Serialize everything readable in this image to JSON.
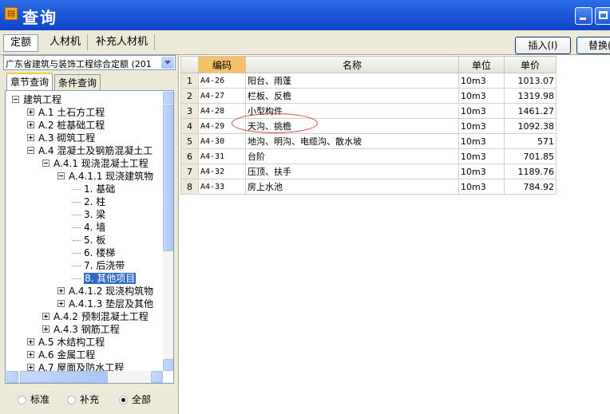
{
  "window": {
    "title": "查询",
    "icon": "app-icon"
  },
  "top_tabs": [
    "定额",
    "人材机",
    "补充人材机"
  ],
  "buttons": {
    "insert": "插入(I)",
    "replace": "替换("
  },
  "left": {
    "dropdown_value": "广东省建筑与装饰工程综合定额 (201",
    "subtabs": [
      "章节查询",
      "条件查询"
    ],
    "tree": [
      {
        "label": "建筑工程",
        "indent": 0,
        "exp": "minus"
      },
      {
        "label": "A.1 土石方工程",
        "indent": 1,
        "exp": "plus"
      },
      {
        "label": "A.2 桩基础工程",
        "indent": 1,
        "exp": "plus"
      },
      {
        "label": "A.3 砌筑工程",
        "indent": 1,
        "exp": "plus"
      },
      {
        "label": "A.4 混凝土及钢筋混凝土工",
        "indent": 1,
        "exp": "minus"
      },
      {
        "label": "A.4.1 现浇混凝土工程",
        "indent": 2,
        "exp": "minus"
      },
      {
        "label": "A.4.1.1 现浇建筑物",
        "indent": 3,
        "exp": "minus"
      },
      {
        "label": "1. 基础",
        "indent": 4,
        "exp": "leaf"
      },
      {
        "label": "2. 柱",
        "indent": 4,
        "exp": "leaf"
      },
      {
        "label": "3. 梁",
        "indent": 4,
        "exp": "leaf"
      },
      {
        "label": "4. 墙",
        "indent": 4,
        "exp": "leaf"
      },
      {
        "label": "5. 板",
        "indent": 4,
        "exp": "leaf"
      },
      {
        "label": "6. 楼梯",
        "indent": 4,
        "exp": "leaf"
      },
      {
        "label": "7. 后浇带",
        "indent": 4,
        "exp": "leaf"
      },
      {
        "label": "8. 其他项目",
        "indent": 4,
        "exp": "leaf",
        "selected": true
      },
      {
        "label": "A.4.1.2 现浇构筑物",
        "indent": 3,
        "exp": "plus"
      },
      {
        "label": "A.4.1.3 垫层及其他",
        "indent": 3,
        "exp": "plus"
      },
      {
        "label": "A.4.2 预制混凝土工程",
        "indent": 2,
        "exp": "plus"
      },
      {
        "label": "A.4.3 钢筋工程",
        "indent": 2,
        "exp": "plus"
      },
      {
        "label": "A.5 木结构工程",
        "indent": 1,
        "exp": "plus"
      },
      {
        "label": "A.6 金属工程",
        "indent": 1,
        "exp": "plus"
      },
      {
        "label": "A.7 屋面及防水工程",
        "indent": 1,
        "exp": "plus"
      }
    ],
    "radios": [
      {
        "label": "标准",
        "checked": false
      },
      {
        "label": "补充",
        "checked": false
      },
      {
        "label": "全部",
        "checked": true
      }
    ]
  },
  "table": {
    "headers": [
      "编码",
      "名称",
      "单位",
      "单价"
    ],
    "rows": [
      {
        "n": "1",
        "code": "A4-26",
        "name": "阳台、雨蓬",
        "unit": "10m3",
        "price": "1013.07"
      },
      {
        "n": "2",
        "code": "A4-27",
        "name": "栏板、反檐",
        "unit": "10m3",
        "price": "1319.98"
      },
      {
        "n": "3",
        "code": "A4-28",
        "name": "小型构件",
        "unit": "10m3",
        "price": "1461.27"
      },
      {
        "n": "4",
        "code": "A4-29",
        "name": "天沟、挑檐",
        "unit": "10m3",
        "price": "1092.38"
      },
      {
        "n": "5",
        "code": "A4-30",
        "name": "地沟、明沟、电缆沟、散水坡",
        "unit": "10m3",
        "price": "571"
      },
      {
        "n": "6",
        "code": "A4-31",
        "name": "台阶",
        "unit": "10m3",
        "price": "701.85"
      },
      {
        "n": "7",
        "code": "A4-32",
        "name": "压顶、扶手",
        "unit": "10m3",
        "price": "1189.76"
      },
      {
        "n": "8",
        "code": "A4-33",
        "name": "房上水池",
        "unit": "10m3",
        "price": "784.92"
      }
    ]
  }
}
